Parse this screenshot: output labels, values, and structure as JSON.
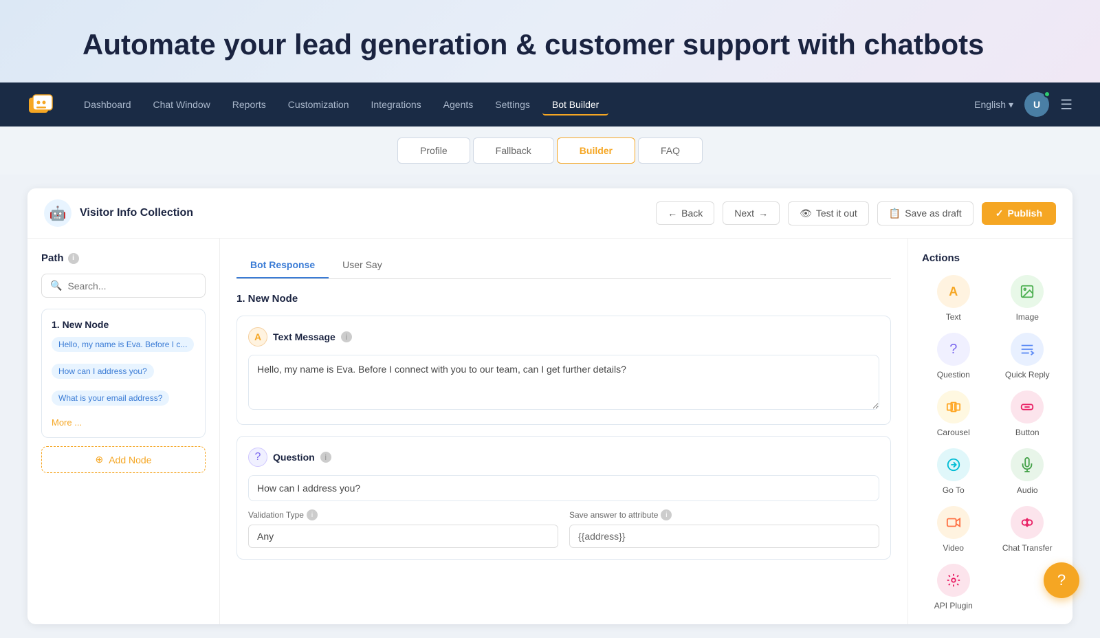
{
  "hero": {
    "title": "Automate your lead generation & customer support with chatbots"
  },
  "navbar": {
    "logo_alt": "logo",
    "items": [
      {
        "label": "Dashboard",
        "active": false
      },
      {
        "label": "Chat Window",
        "active": false
      },
      {
        "label": "Reports",
        "active": false
      },
      {
        "label": "Customization",
        "active": false
      },
      {
        "label": "Integrations",
        "active": false
      },
      {
        "label": "Agents",
        "active": false
      },
      {
        "label": "Settings",
        "active": false
      },
      {
        "label": "Bot Builder",
        "active": true
      }
    ],
    "language": "English",
    "avatar_initial": "U"
  },
  "sub_tabs": {
    "tabs": [
      {
        "label": "Profile",
        "active": false
      },
      {
        "label": "Fallback",
        "active": false
      },
      {
        "label": "Builder",
        "active": true
      },
      {
        "label": "FAQ",
        "active": false
      }
    ]
  },
  "bot_header": {
    "icon": "🤖",
    "title": "Visitor Info Collection",
    "back_label": "Back",
    "next_label": "Next",
    "test_label": "Test it out",
    "draft_label": "Save as draft",
    "publish_label": "Publish"
  },
  "path": {
    "title": "Path",
    "search_placeholder": "Search...",
    "node": {
      "title": "1. New Node",
      "tags": [
        "Hello, my name is Eva. Before I c...",
        "How can I address you?",
        "What is your email address?"
      ],
      "more_label": "More ..."
    },
    "add_node_label": "Add Node"
  },
  "middle": {
    "tabs": [
      {
        "label": "Bot Response",
        "active": true
      },
      {
        "label": "User Say",
        "active": false
      }
    ],
    "node_title": "1.  New Node",
    "text_message": {
      "label": "Text Message",
      "icon": "A",
      "content": "Hello, my name is Eva. Before I connect with you to our team, can I get further details?"
    },
    "question": {
      "label": "Question",
      "icon": "?",
      "value": "How can I address you?",
      "validation_label": "Validation Type",
      "validation_info": "ℹ",
      "validation_value": "Any",
      "save_label": "Save answer to attribute",
      "save_info": "ℹ",
      "save_value": "{{address}}"
    }
  },
  "actions": {
    "title": "Actions",
    "items": [
      {
        "label": "Text",
        "icon": "A",
        "icon_class": "icon-text"
      },
      {
        "label": "Image",
        "icon": "🖼",
        "icon_class": "icon-image"
      },
      {
        "label": "Question",
        "icon": "?",
        "icon_class": "icon-question"
      },
      {
        "label": "Quick Reply",
        "icon": "≡",
        "icon_class": "icon-quickreply"
      },
      {
        "label": "Carousel",
        "icon": "⊟",
        "icon_class": "icon-carousel"
      },
      {
        "label": "Button",
        "icon": "▣",
        "icon_class": "icon-button"
      },
      {
        "label": "Go To",
        "icon": "↗",
        "icon_class": "icon-goto"
      },
      {
        "label": "Audio",
        "icon": "🎤",
        "icon_class": "icon-audio"
      },
      {
        "label": "Video",
        "icon": "📹",
        "icon_class": "icon-video"
      },
      {
        "label": "Chat Transfer",
        "icon": "↔",
        "icon_class": "icon-chattransfer"
      },
      {
        "label": "API Plugin",
        "icon": "⚙",
        "icon_class": "icon-apiplugin"
      }
    ]
  },
  "fab": {
    "icon": "?"
  }
}
